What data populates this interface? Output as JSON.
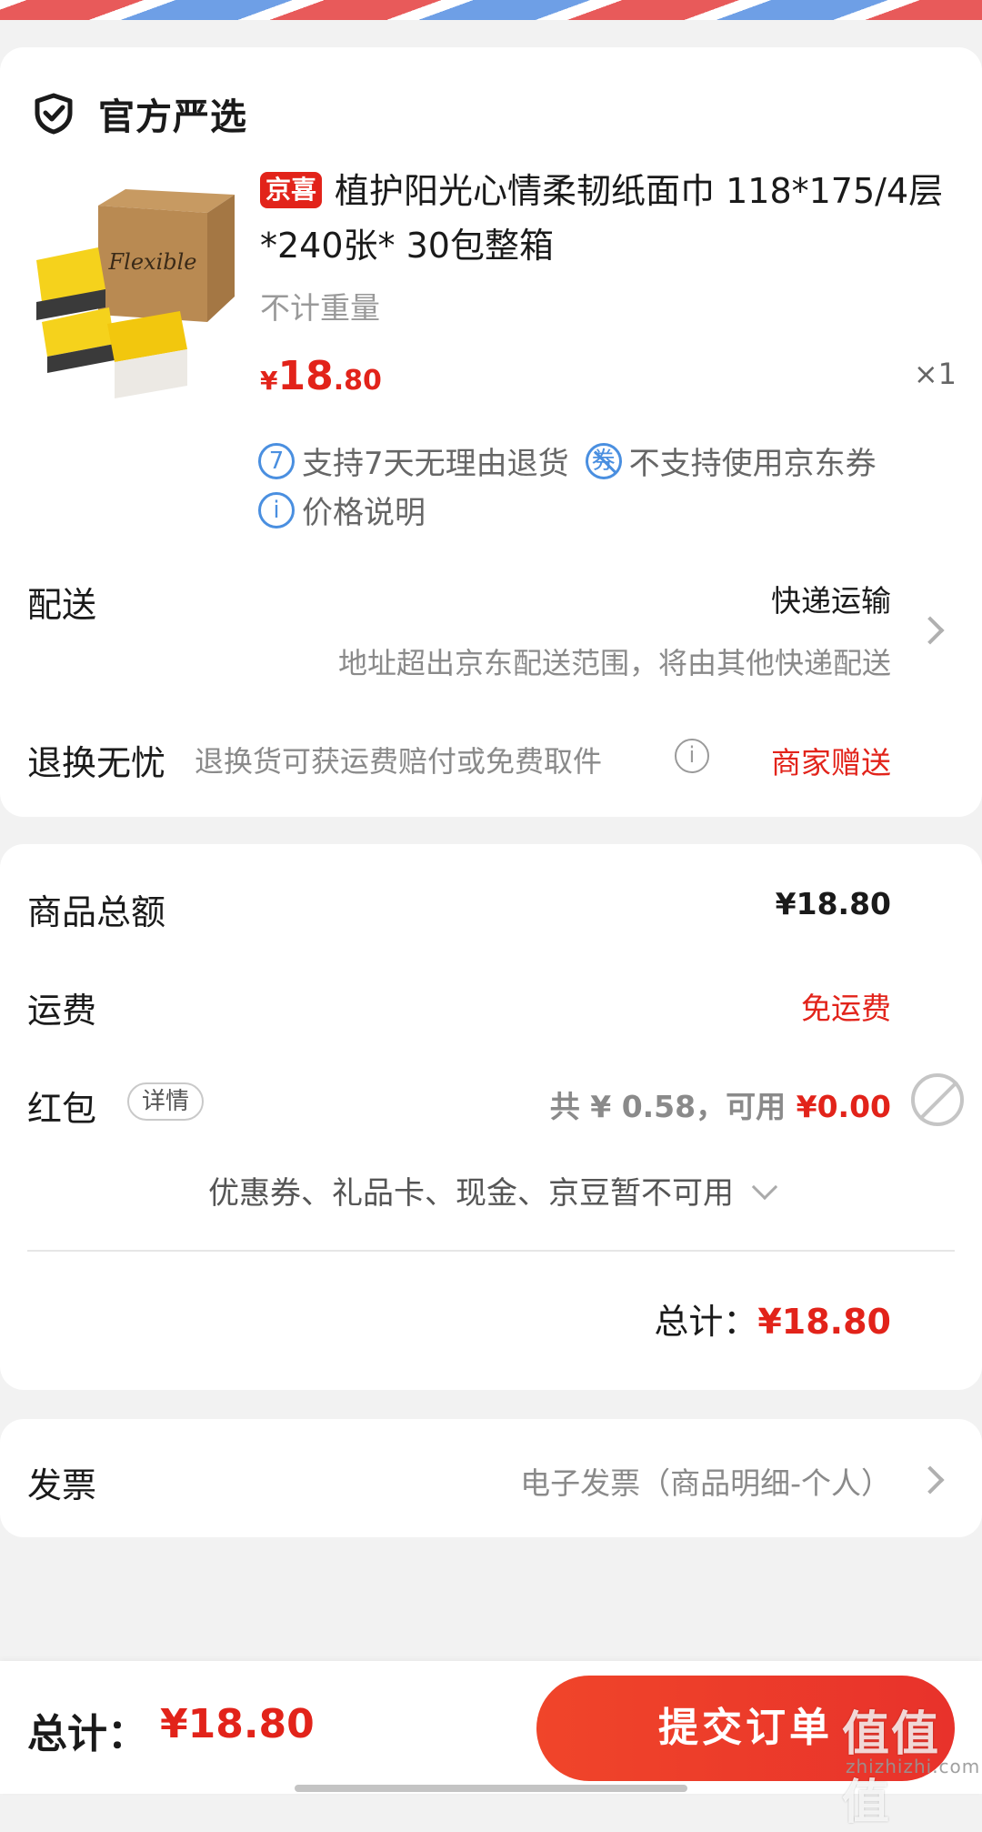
{
  "shop": {
    "badge_label": "官方严选",
    "icon": "shield-check-icon"
  },
  "product": {
    "tag": "京喜",
    "title": "植护阳光心情柔韧纸面巾 118*175/4层*240张* 30包整箱",
    "weight_note": "不计重量",
    "price_currency": "¥",
    "price_int": "18",
    "price_dec": ".80",
    "quantity": "×1",
    "services": [
      {
        "icon_text": "7",
        "label": "支持7天无理由退货"
      },
      {
        "icon_text": "券",
        "label": "不支持使用京东券"
      },
      {
        "icon_text": "i",
        "label": "价格说明"
      }
    ],
    "image_brand_text": "Flexible"
  },
  "delivery": {
    "label": "配送",
    "method": "快递运输",
    "note": "地址超出京东配送范围，将由其他快递配送"
  },
  "returns": {
    "label": "退换无忧",
    "desc": "退换货可获运费赔付或免费取件",
    "value": "商家赠送"
  },
  "summary": {
    "goods_total_label": "商品总额",
    "goods_total_value": "¥18.80",
    "shipping_label": "运费",
    "shipping_value": "免运费",
    "redpacket_label": "红包",
    "redpacket_detail_tag": "详情",
    "redpacket_total": "共 ¥ 0.58，可用 ",
    "redpacket_available": "¥0.00",
    "unavailable_note": "优惠券、礼品卡、现金、京豆暂不可用",
    "total_label": "总计：",
    "total_value": "¥18.80"
  },
  "invoice": {
    "label": "发票",
    "value": "电子发票（商品明细-个人）"
  },
  "bottom_bar": {
    "total_label": "总计：",
    "total_value": "¥18.80",
    "submit_label": "提交订单"
  },
  "watermark": {
    "main": "值值值",
    "sub": "zhizhizhi.com"
  },
  "colors": {
    "accent_red": "#e2231a",
    "service_blue": "#4a8fe0",
    "stripe_red": "#e85a5a",
    "stripe_blue": "#6e9fe6"
  }
}
